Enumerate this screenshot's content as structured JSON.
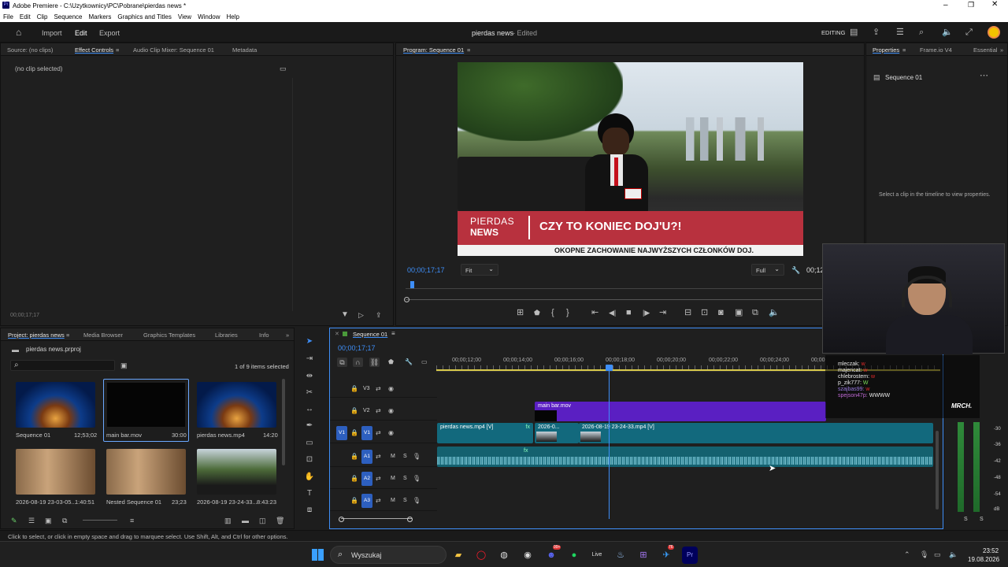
{
  "window": {
    "title": "Adobe Premiere - C:\\Uzytkownicy\\PC\\Pobrane\\pierdas news *"
  },
  "menu": [
    "File",
    "Edit",
    "Clip",
    "Sequence",
    "Markers",
    "Graphics and Titles",
    "View",
    "Window",
    "Help"
  ],
  "header": {
    "tabs": [
      "Import",
      "Edit",
      "Export"
    ],
    "active_tab": "Edit",
    "project_title": "pierdas news",
    "status": "- Edited",
    "workspace": "EDITING"
  },
  "source_panel": {
    "tabs": [
      "Source: (no clips)",
      "Effect Controls",
      "Audio Clip Mixer: Sequence 01",
      "Metadata"
    ],
    "active": "Effect Controls",
    "empty_text": "(no clip selected)",
    "timecode": "00;00;17;17"
  },
  "program": {
    "tab": "Program: Sequence 01",
    "timecode": "00;00;17;17",
    "timecode_right": "00;12",
    "fit": "Fit",
    "quality": "Full",
    "overlay": {
      "brand_top": "PIERDAS",
      "brand_bottom": "NEWS",
      "headline": "CZY TO KONIEC DOJ'U?!",
      "subheadline": "OKOPNE ZACHOWANIE NAJWYŻSZYCH CZŁONKÓW DOJ."
    }
  },
  "properties": {
    "tabs": [
      "Properties",
      "Frame.io V4",
      "Essential"
    ],
    "item": "Sequence 01",
    "hint": "Select a clip in the timeline to view properties."
  },
  "project": {
    "tabs": [
      "Project: pierdas news",
      "Media Browser",
      "Graphics Templates",
      "Libraries",
      "Info"
    ],
    "file": "pierdas news.prproj",
    "selection": "1 of 9 items selected",
    "items": [
      {
        "name": "Sequence 01",
        "duration": "12;53;02"
      },
      {
        "name": "main bar.mov",
        "duration": "30:00"
      },
      {
        "name": "pierdas news.mp4",
        "duration": "14:20"
      },
      {
        "name": "2026-08-19 23-03-05...",
        "duration": "1:40:51"
      },
      {
        "name": "Nested Sequence 01",
        "duration": "23;23"
      },
      {
        "name": "2026-08-19 23-24-33...",
        "duration": "8:43:23"
      }
    ]
  },
  "timeline": {
    "tab": "Sequence 01",
    "timecode": "00;00;17;17",
    "ruler": [
      "00;00;12;00",
      "00;00;14;00",
      "00;00;16;00",
      "00;00;18;00",
      "00;00;20;00",
      "00;00;22;00",
      "00;00;24;00",
      "00;00"
    ],
    "video_tracks": [
      "V3",
      "V2",
      "V1"
    ],
    "audio_tracks": [
      "A1",
      "A2",
      "A3"
    ],
    "track_buttons": {
      "mute": "M",
      "solo": "S"
    },
    "source_patch": "V1",
    "clips": {
      "v2": "main bar.mov",
      "v1a": "pierdas news.mp4 [V]",
      "v1b": "2026-0...",
      "v1c": "2026-08-19 23-24-33.mp4 [V]",
      "fx": "fx"
    }
  },
  "meter": {
    "labels": [
      "-30",
      "-36",
      "-42",
      "-48",
      "-54",
      "dB"
    ],
    "channels": [
      "S",
      "S"
    ]
  },
  "webcam_chat": [
    {
      "user": "mleczak:",
      "msg": "w"
    },
    {
      "user": "majencat:",
      "msg": "w"
    },
    {
      "user": "chlebrostem:",
      "msg": "w"
    },
    {
      "user": "p_zik777:",
      "msg": "W"
    },
    {
      "user": "szajbas99:",
      "msg": "w"
    },
    {
      "user": "spejson47p:",
      "msg": "WWWW"
    }
  ],
  "webcam_logo": "MRCH.",
  "status_bar": "Click to select, or click in empty space and drag to marquee select. Use Shift, Alt, and Ctrl for other options.",
  "taskbar": {
    "search": "Wyszukaj",
    "time": "23:52",
    "date": "19.08.2026",
    "badge1": "99+",
    "badge2": "76"
  },
  "colors": {
    "accent": "#3e8ef7",
    "v2_clip": "#5a1fc2",
    "v1_clip": "#12697d",
    "audio_clip": "#14616f",
    "news_red": "#b8313e"
  }
}
